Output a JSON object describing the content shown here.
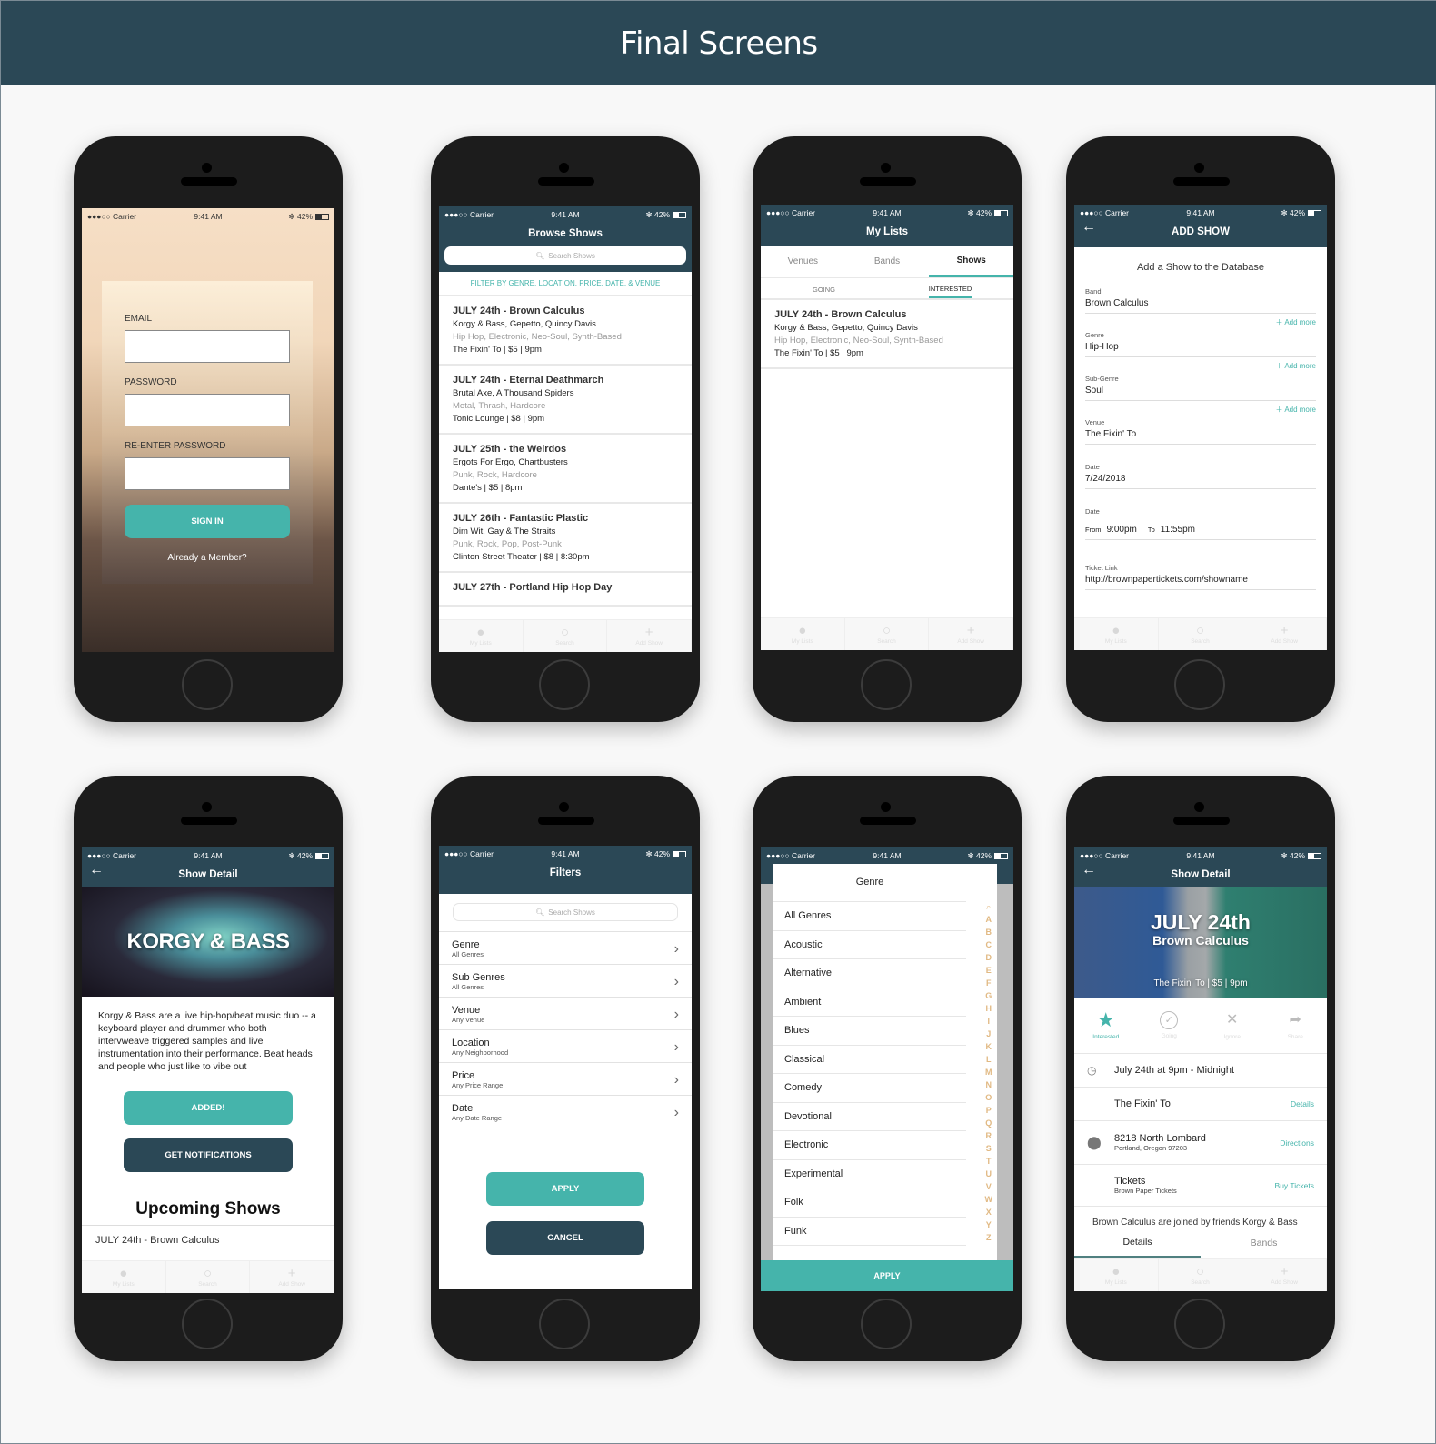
{
  "page": {
    "title": "Final Screens"
  },
  "status_bar": {
    "carrier": "●●●○○ Carrier",
    "time": "9:41 AM",
    "battery": "42%"
  },
  "tab_bar": [
    {
      "label": "My Lists",
      "icon": "person-icon"
    },
    {
      "label": "Search",
      "icon": "search-icon"
    },
    {
      "label": "Add Show",
      "icon": "plus-icon"
    }
  ],
  "colors": {
    "navy": "#2b4856",
    "teal": "#45b4ab",
    "alpha_index": "#e1b983"
  },
  "signup": {
    "email_label": "EMAIL",
    "email_value": "",
    "password_label": "PASSWORD",
    "password_value": "",
    "reenter_label": "RE-ENTER PASSWORD",
    "reenter_value": "",
    "sign_in": "SIGN IN",
    "member_link": "Already a Member?"
  },
  "browse": {
    "title": "Browse Shows",
    "search_placeholder": "Search Shows",
    "filter_link": "FILTER BY GENRE, LOCATION, PRICE, DATE, & VENUE",
    "shows": [
      {
        "heading": "JULY 24th - Brown Calculus",
        "bands": "Korgy & Bass, Gepetto, Quincy Davis",
        "genres": "Hip Hop, Electronic, Neo-Soul, Synth-Based",
        "venue": "The Fixin' To | $5 | 9pm"
      },
      {
        "heading": "JULY 24th - Eternal Deathmarch",
        "bands": "Brutal Axe, A Thousand Spiders",
        "genres": "Metal, Thrash, Hardcore",
        "venue": "Tonic Lounge | $8 | 9pm"
      },
      {
        "heading": "JULY 25th - the Weirdos",
        "bands": "Ergots For Ergo, Chartbusters",
        "genres": "Punk, Rock, Hardcore",
        "venue": "Dante's | $5 | 8pm"
      },
      {
        "heading": "JULY 26th - Fantastic Plastic",
        "bands": "Dim Wit, Gay & The Straits",
        "genres": "Punk, Rock, Pop, Post-Punk",
        "venue": "Clinton Street Theater | $8 | 8:30pm"
      },
      {
        "heading": "JULY 27th - Portland Hip Hop Day",
        "bands": "",
        "genres": "",
        "venue": ""
      }
    ]
  },
  "mylists": {
    "title": "My Lists",
    "tabs": [
      "Venues",
      "Bands",
      "Shows"
    ],
    "active_tab": "Shows",
    "subtabs": [
      "GOING",
      "INTERESTED"
    ],
    "active_subtab": "INTERESTED",
    "shows": [
      {
        "heading": "JULY 24th - Brown Calculus",
        "bands": "Korgy & Bass, Gepetto, Quincy Davis",
        "genres": "Hip Hop, Electronic, Neo-Soul, Synth-Based",
        "venue": "The Fixin' To | $5 | 9pm"
      }
    ]
  },
  "addshow": {
    "title": "ADD SHOW",
    "heading": "Add a Show to the Database",
    "add_more": "Add more",
    "fields": {
      "band": {
        "label": "Band",
        "value": "Brown Calculus"
      },
      "genre": {
        "label": "Genre",
        "value": "Hip-Hop"
      },
      "subgenre": {
        "label": "Sub-Genre",
        "value": "Soul"
      },
      "venue": {
        "label": "Venue",
        "value": "The Fixin' To"
      },
      "date": {
        "label": "Date",
        "value": "7/24/2018"
      },
      "time": {
        "label": "Date",
        "from_label": "From",
        "from": "9:00pm",
        "to_label": "To",
        "to": "11:55pm"
      },
      "ticket": {
        "label": "Ticket Link",
        "value": "http://brownpapertickets.com/showname"
      }
    }
  },
  "banddetail": {
    "title": "Show Detail",
    "hero": "KORGY & BASS",
    "description": "Korgy & Bass are a live hip-hop/beat music duo -- a keyboard player and drummer who both intervweave triggered samples and live instrumentation into their performance.  Beat heads and people who just like to vibe out",
    "added": "ADDED!",
    "notify": "GET NOTIFICATIONS",
    "upcoming": "Upcoming Shows",
    "upcoming_item": "JULY 24th - Brown Calculus"
  },
  "filters": {
    "title": "Filters",
    "search_placeholder": "Search Shows",
    "rows": [
      {
        "title": "Genre",
        "sub": "All Genres"
      },
      {
        "title": "Sub Genres",
        "sub": "All Genres"
      },
      {
        "title": "Venue",
        "sub": "Any Venue"
      },
      {
        "title": "Location",
        "sub": "Any Neighborhood"
      },
      {
        "title": "Price",
        "sub": "Any Price Range"
      },
      {
        "title": "Date",
        "sub": "Any Date Range"
      }
    ],
    "apply": "APPLY",
    "cancel": "CANCEL"
  },
  "genre": {
    "title": "Genre",
    "items": [
      "All Genres",
      "Acoustic",
      "Alternative",
      "Ambient",
      "Blues",
      "Classical",
      "Comedy",
      "Devotional",
      "Electronic",
      "Experimental",
      "Folk",
      "Funk"
    ],
    "index": [
      "A",
      "B",
      "C",
      "D",
      "E",
      "F",
      "G",
      "H",
      "I",
      "J",
      "K",
      "L",
      "M",
      "N",
      "O",
      "P",
      "Q",
      "R",
      "S",
      "T",
      "U",
      "V",
      "W",
      "X",
      "Y",
      "Z"
    ],
    "apply": "APPLY"
  },
  "showdetail": {
    "title": "Show Detail",
    "hero_date": "JULY 24th",
    "hero_band": "Brown Calculus",
    "hero_info": "The Fixin' To | $5 | 9pm",
    "actions": [
      {
        "label": "Interested",
        "icon": "star-icon",
        "active": true
      },
      {
        "label": "Going",
        "icon": "check-circle-icon",
        "active": false
      },
      {
        "label": "Ignore",
        "icon": "x-icon",
        "active": false
      },
      {
        "label": "Share",
        "icon": "share-icon",
        "active": false
      }
    ],
    "time": "July 24th at 9pm - Midnight",
    "venue": "The Fixin' To",
    "venue_link": "Details",
    "address": "8218 North Lombard",
    "city": "Portland, Oregon 97203",
    "address_link": "Directions",
    "tickets": "Tickets",
    "tickets_sub": "Brown Paper Tickets",
    "tickets_link": "Buy Tickets",
    "blurb": "Brown Calculus are joined by friends Korgy & Bass",
    "tabs": [
      "Details",
      "Bands"
    ]
  }
}
